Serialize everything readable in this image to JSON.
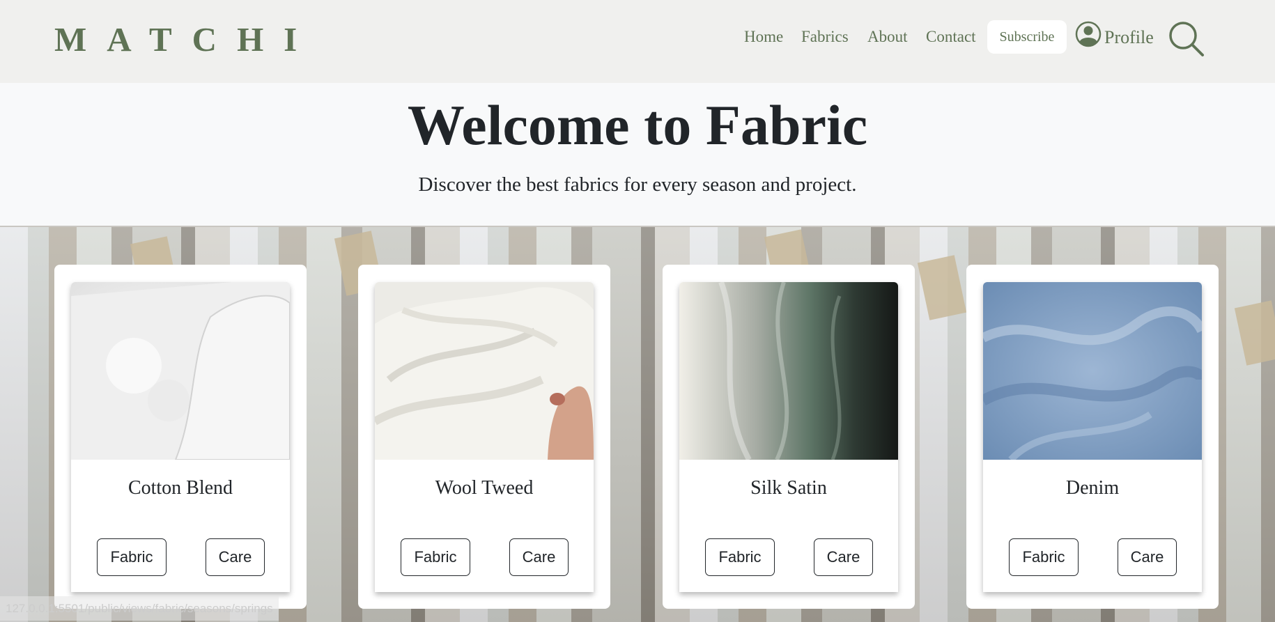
{
  "header": {
    "logo": "MATCHI",
    "nav": [
      "Home",
      "Fabrics",
      "About",
      "Contact"
    ],
    "subscribe_label": "Subscribe",
    "profile_label": "Profile",
    "brand_color": "#5f7355"
  },
  "hero": {
    "title": "Welcome to Fabric",
    "subtitle": "Discover the best fabrics for every season and project."
  },
  "cards": [
    {
      "title": "Cotton Blend",
      "fabric_label": "Fabric",
      "care_label": "Care"
    },
    {
      "title": "Wool Tweed",
      "fabric_label": "Fabric",
      "care_label": "Care"
    },
    {
      "title": "Silk Satin",
      "fabric_label": "Fabric",
      "care_label": "Care"
    },
    {
      "title": "Denim",
      "fabric_label": "Fabric",
      "care_label": "Care"
    }
  ],
  "status_url": "127.0.0.1:5501/public/views/fabric/seasons/springs"
}
